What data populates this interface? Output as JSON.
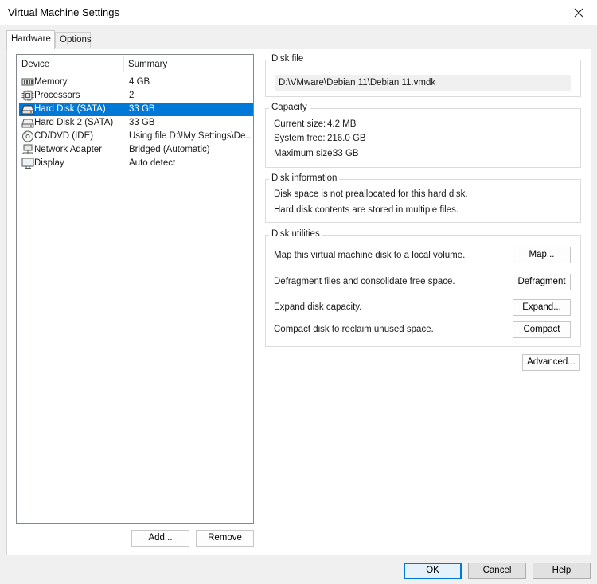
{
  "window": {
    "title": "Virtual Machine Settings"
  },
  "tabs": [
    {
      "label": "Hardware"
    },
    {
      "label": "Options"
    }
  ],
  "device_list": {
    "headers": {
      "device": "Device",
      "summary": "Summary"
    },
    "rows": [
      {
        "device": "Memory",
        "summary": "4 GB",
        "icon": "memory-icon"
      },
      {
        "device": "Processors",
        "summary": "2",
        "icon": "processor-icon"
      },
      {
        "device": "Hard Disk (SATA)",
        "summary": "33 GB",
        "icon": "hard-disk-icon"
      },
      {
        "device": "Hard Disk 2 (SATA)",
        "summary": "33 GB",
        "icon": "hard-disk-icon"
      },
      {
        "device": "CD/DVD (IDE)",
        "summary": "Using file D:\\!My Settings\\De...",
        "icon": "cd-dvd-icon"
      },
      {
        "device": "Network Adapter",
        "summary": "Bridged (Automatic)",
        "icon": "network-adapter-icon"
      },
      {
        "device": "Display",
        "summary": "Auto detect",
        "icon": "display-icon"
      }
    ],
    "selected_index": 2
  },
  "list_buttons": {
    "add": "Add...",
    "remove": "Remove"
  },
  "disk_file": {
    "label": "Disk file",
    "value": "D:\\VMware\\Debian 11\\Debian 11.vmdk"
  },
  "capacity": {
    "label": "Capacity",
    "current_size_label": "Current size:",
    "current_size": "4.2 MB",
    "system_free_label": "System free:",
    "system_free": "216.0 GB",
    "max_size_label": "Maximum size:",
    "max_size": "33 GB"
  },
  "disk_information": {
    "label": "Disk information",
    "line1": "Disk space is not preallocated for this hard disk.",
    "line2": "Hard disk contents are stored in multiple files."
  },
  "disk_utilities": {
    "label": "Disk utilities",
    "map_text": "Map this virtual machine disk to a local volume.",
    "map_button": "Map...",
    "defrag_text": "Defragment files and consolidate free space.",
    "defrag_button": "Defragment",
    "expand_text": "Expand disk capacity.",
    "expand_button": "Expand...",
    "compact_text": "Compact disk to reclaim unused space.",
    "compact_button": "Compact"
  },
  "advanced_button": "Advanced...",
  "footer": {
    "ok": "OK",
    "cancel": "Cancel",
    "help": "Help"
  },
  "colors": {
    "selection": "#0078d7",
    "window_bg": "#f0f0f0",
    "panel_bg": "#ffffff"
  }
}
